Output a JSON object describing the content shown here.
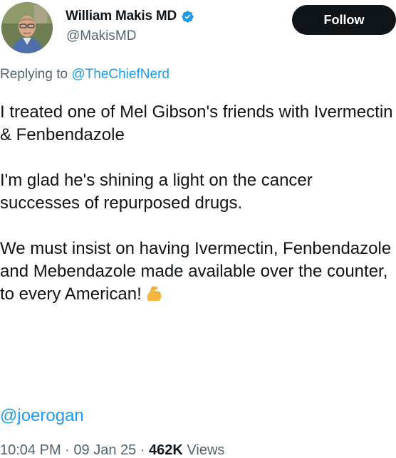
{
  "author": {
    "display_name": "William Makis MD",
    "handle": "@MakisMD",
    "verified": true
  },
  "follow_label": "Follow",
  "reply": {
    "prefix": "Replying to",
    "mention": "@TheChiefNerd"
  },
  "body": {
    "paragraphs": [
      "I treated one of Mel Gibson's friends with Ivermectin & Fenbendazole",
      "I'm glad he's shining a light on the cancer successes of repurposed drugs.",
      "We must insist on having Ivermectin, Fenbendazole and Mebendazole made available over the counter, to every American!"
    ],
    "mention": "@joerogan"
  },
  "meta": {
    "time": "10:04 PM",
    "sep1": " · ",
    "date": "09 Jan 25",
    "sep2": " · ",
    "views_count": "462K",
    "views_label": "Views"
  },
  "colors": {
    "link": "#1d9bf0",
    "secondary": "#536471",
    "primary": "#0f1419",
    "verified": "#1d9bf0"
  },
  "icons": {
    "verified": "verified-badge-icon",
    "emoji": "flexed-biceps-emoji"
  }
}
